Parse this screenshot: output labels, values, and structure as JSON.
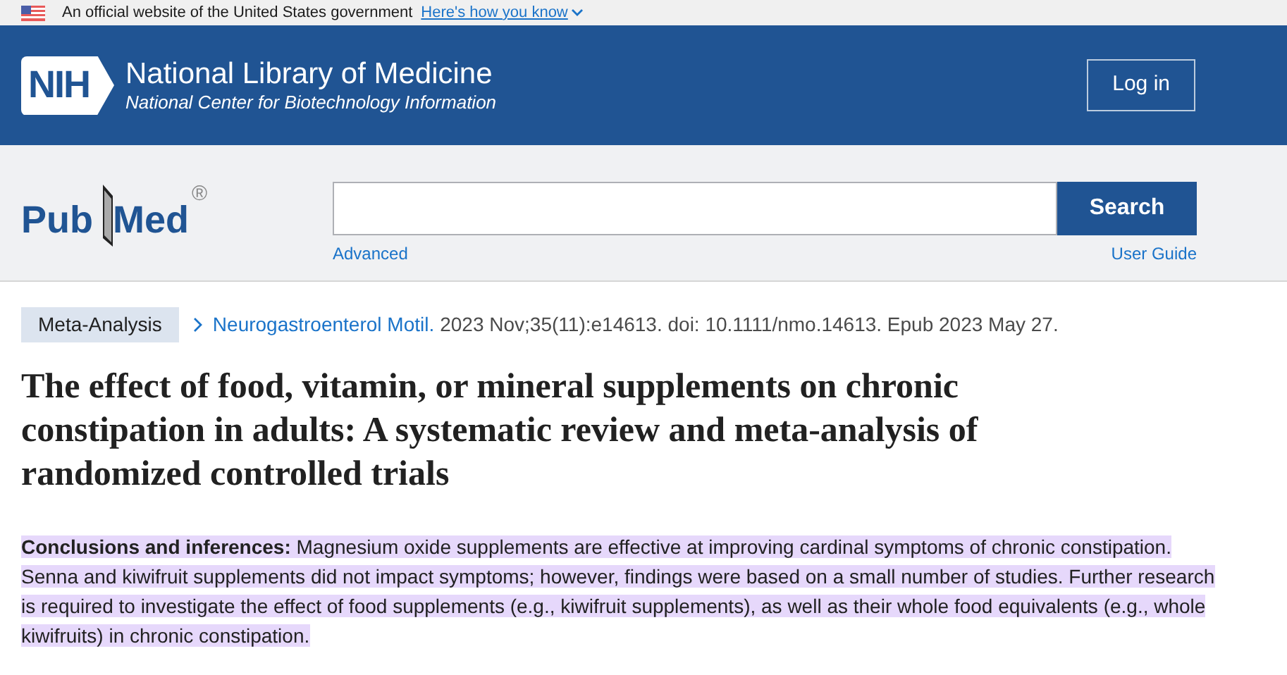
{
  "banner": {
    "text": "An official website of the United States government",
    "link": "Here's how you know"
  },
  "header": {
    "logo_text": "NIH",
    "title": "National Library of Medicine",
    "subtitle": "National Center for Biotechnology Information",
    "login": "Log in"
  },
  "search": {
    "logo_left": "Pub",
    "logo_right": "Med",
    "registered": "®",
    "button": "Search",
    "advanced": "Advanced",
    "guide": "User Guide"
  },
  "article": {
    "type_badge": "Meta-Analysis",
    "journal": "Neurogastroenterol Motil.",
    "citation": "2023 Nov;35(11):e14613. doi: 10.1111/nmo.14613. Epub 2023 May 27.",
    "title": "The effect of food, vitamin, or mineral supplements on chronic constipation in adults: A systematic review and meta-analysis of randomized controlled trials",
    "abstract": "**Conclusions and inferences:** Magnesium oxide supplements are effective at improving cardinal symptoms of chronic constipation. Senna and kiwifruit supplements did not impact symptoms; however, findings were based on a small number of studies. Further research is required to investigate the effect of food supplements (e.g., kiwifruit supplements), as well as their whole food equivalents (e.g., whole kiwifruits) in chronic constipation.",
    "highlighted": true
  }
}
